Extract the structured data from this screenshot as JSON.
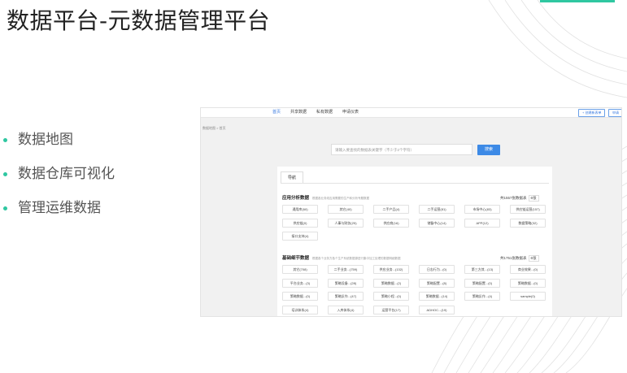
{
  "slide": {
    "title": "数据平台-元数据管理平台",
    "bullets": [
      "数据地图",
      "数据仓库可视化",
      "管理运维数据"
    ],
    "accent_color": "#2fc7a1"
  },
  "screenshot": {
    "nav": [
      "首页",
      "共享数据",
      "私有数据",
      "申请仪表"
    ],
    "nav_active_index": 0,
    "toolbar_buttons": [
      "+ 创建新表单",
      "申请"
    ],
    "breadcrumb": "数据地图 > 首页",
    "search": {
      "placeholder": "请输入要查找的数据表关键字（不少于2个字符）",
      "button": "搜索"
    },
    "tab": "导航",
    "sections": [
      {
        "title": "应用分析数据",
        "subtitle": "根据各业务线应用需要的生产和分析专题数据",
        "total": "共1557张数据表",
        "select": "6张",
        "chips": [
          "通用库(60)",
          "其它(40)",
          "二手产品(4)",
          "二手运营(81)",
          "市场中心(83)",
          "供应链运营(157)",
          "供应链(0)",
          "人事与财务(25)",
          "供应商(16)",
          "储备中心(14)",
          "APP(12)",
          "数据策略(32)",
          "接口支持(4)"
        ]
      },
      {
        "title": "基础细节数据",
        "subtitle": "根据各个业务方各个生产系统数据源进行集中加工处理的数据明细数据",
        "total": "共1751张数据表",
        "select": "6张",
        "chips": [
          "其它(708)",
          "二手业务...(759)",
          "供应业务...(132)",
          "日志行为...(0)",
          "第三方其...(13)",
          "商业效果...(0)",
          "平台业务...(3)",
          "策略设备...(28)",
          "策略数据...(2)",
          "策略配置...(8)",
          "策略配置...(0)",
          "策略数据...(0)",
          "策略数据...(0)",
          "策略反作...(47)",
          "策略小程...(0)",
          "策略数据...(14)",
          "策略反作...(4)",
          "sample(0)",
          "培训体系(4)",
          "入库体系(4)",
          "运营平台(17)",
          "ADHOC...(19)"
        ]
      }
    ]
  }
}
